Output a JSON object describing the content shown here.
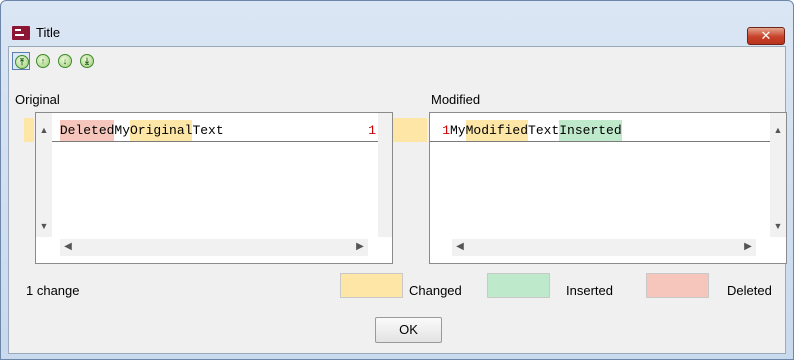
{
  "window": {
    "title": "Title",
    "close_label": "✕"
  },
  "toolbar": {
    "buttons": [
      {
        "name": "first-change",
        "glyph": "⤒"
      },
      {
        "name": "previous-change",
        "glyph": "↑"
      },
      {
        "name": "next-change",
        "glyph": "↓"
      },
      {
        "name": "last-change",
        "glyph": "⤓"
      }
    ]
  },
  "original": {
    "label": "Original",
    "line_number": "1",
    "segments": [
      {
        "text": "Deleted",
        "kind": "deleted"
      },
      {
        "text": " My ",
        "kind": "normal"
      },
      {
        "text": "Original",
        "kind": "changed"
      },
      {
        "text": " Text",
        "kind": "normal"
      }
    ]
  },
  "modified": {
    "label": "Modified",
    "line_number": "1",
    "segments": [
      {
        "text": "My ",
        "kind": "normal"
      },
      {
        "text": "Modified",
        "kind": "changed"
      },
      {
        "text": " Text ",
        "kind": "normal"
      },
      {
        "text": "Inserted",
        "kind": "inserted"
      }
    ]
  },
  "status": {
    "change_count": "1 change"
  },
  "legend": {
    "changed_label": "Changed",
    "inserted_label": "Inserted",
    "deleted_label": "Deleted",
    "changed_color": "#fde6a6",
    "inserted_color": "#bfe9cb",
    "deleted_color": "#f6c6bd"
  },
  "buttons": {
    "ok_label": "OK"
  },
  "colors": {
    "close_button": "#c8412a",
    "line_number": "#cc0000"
  }
}
